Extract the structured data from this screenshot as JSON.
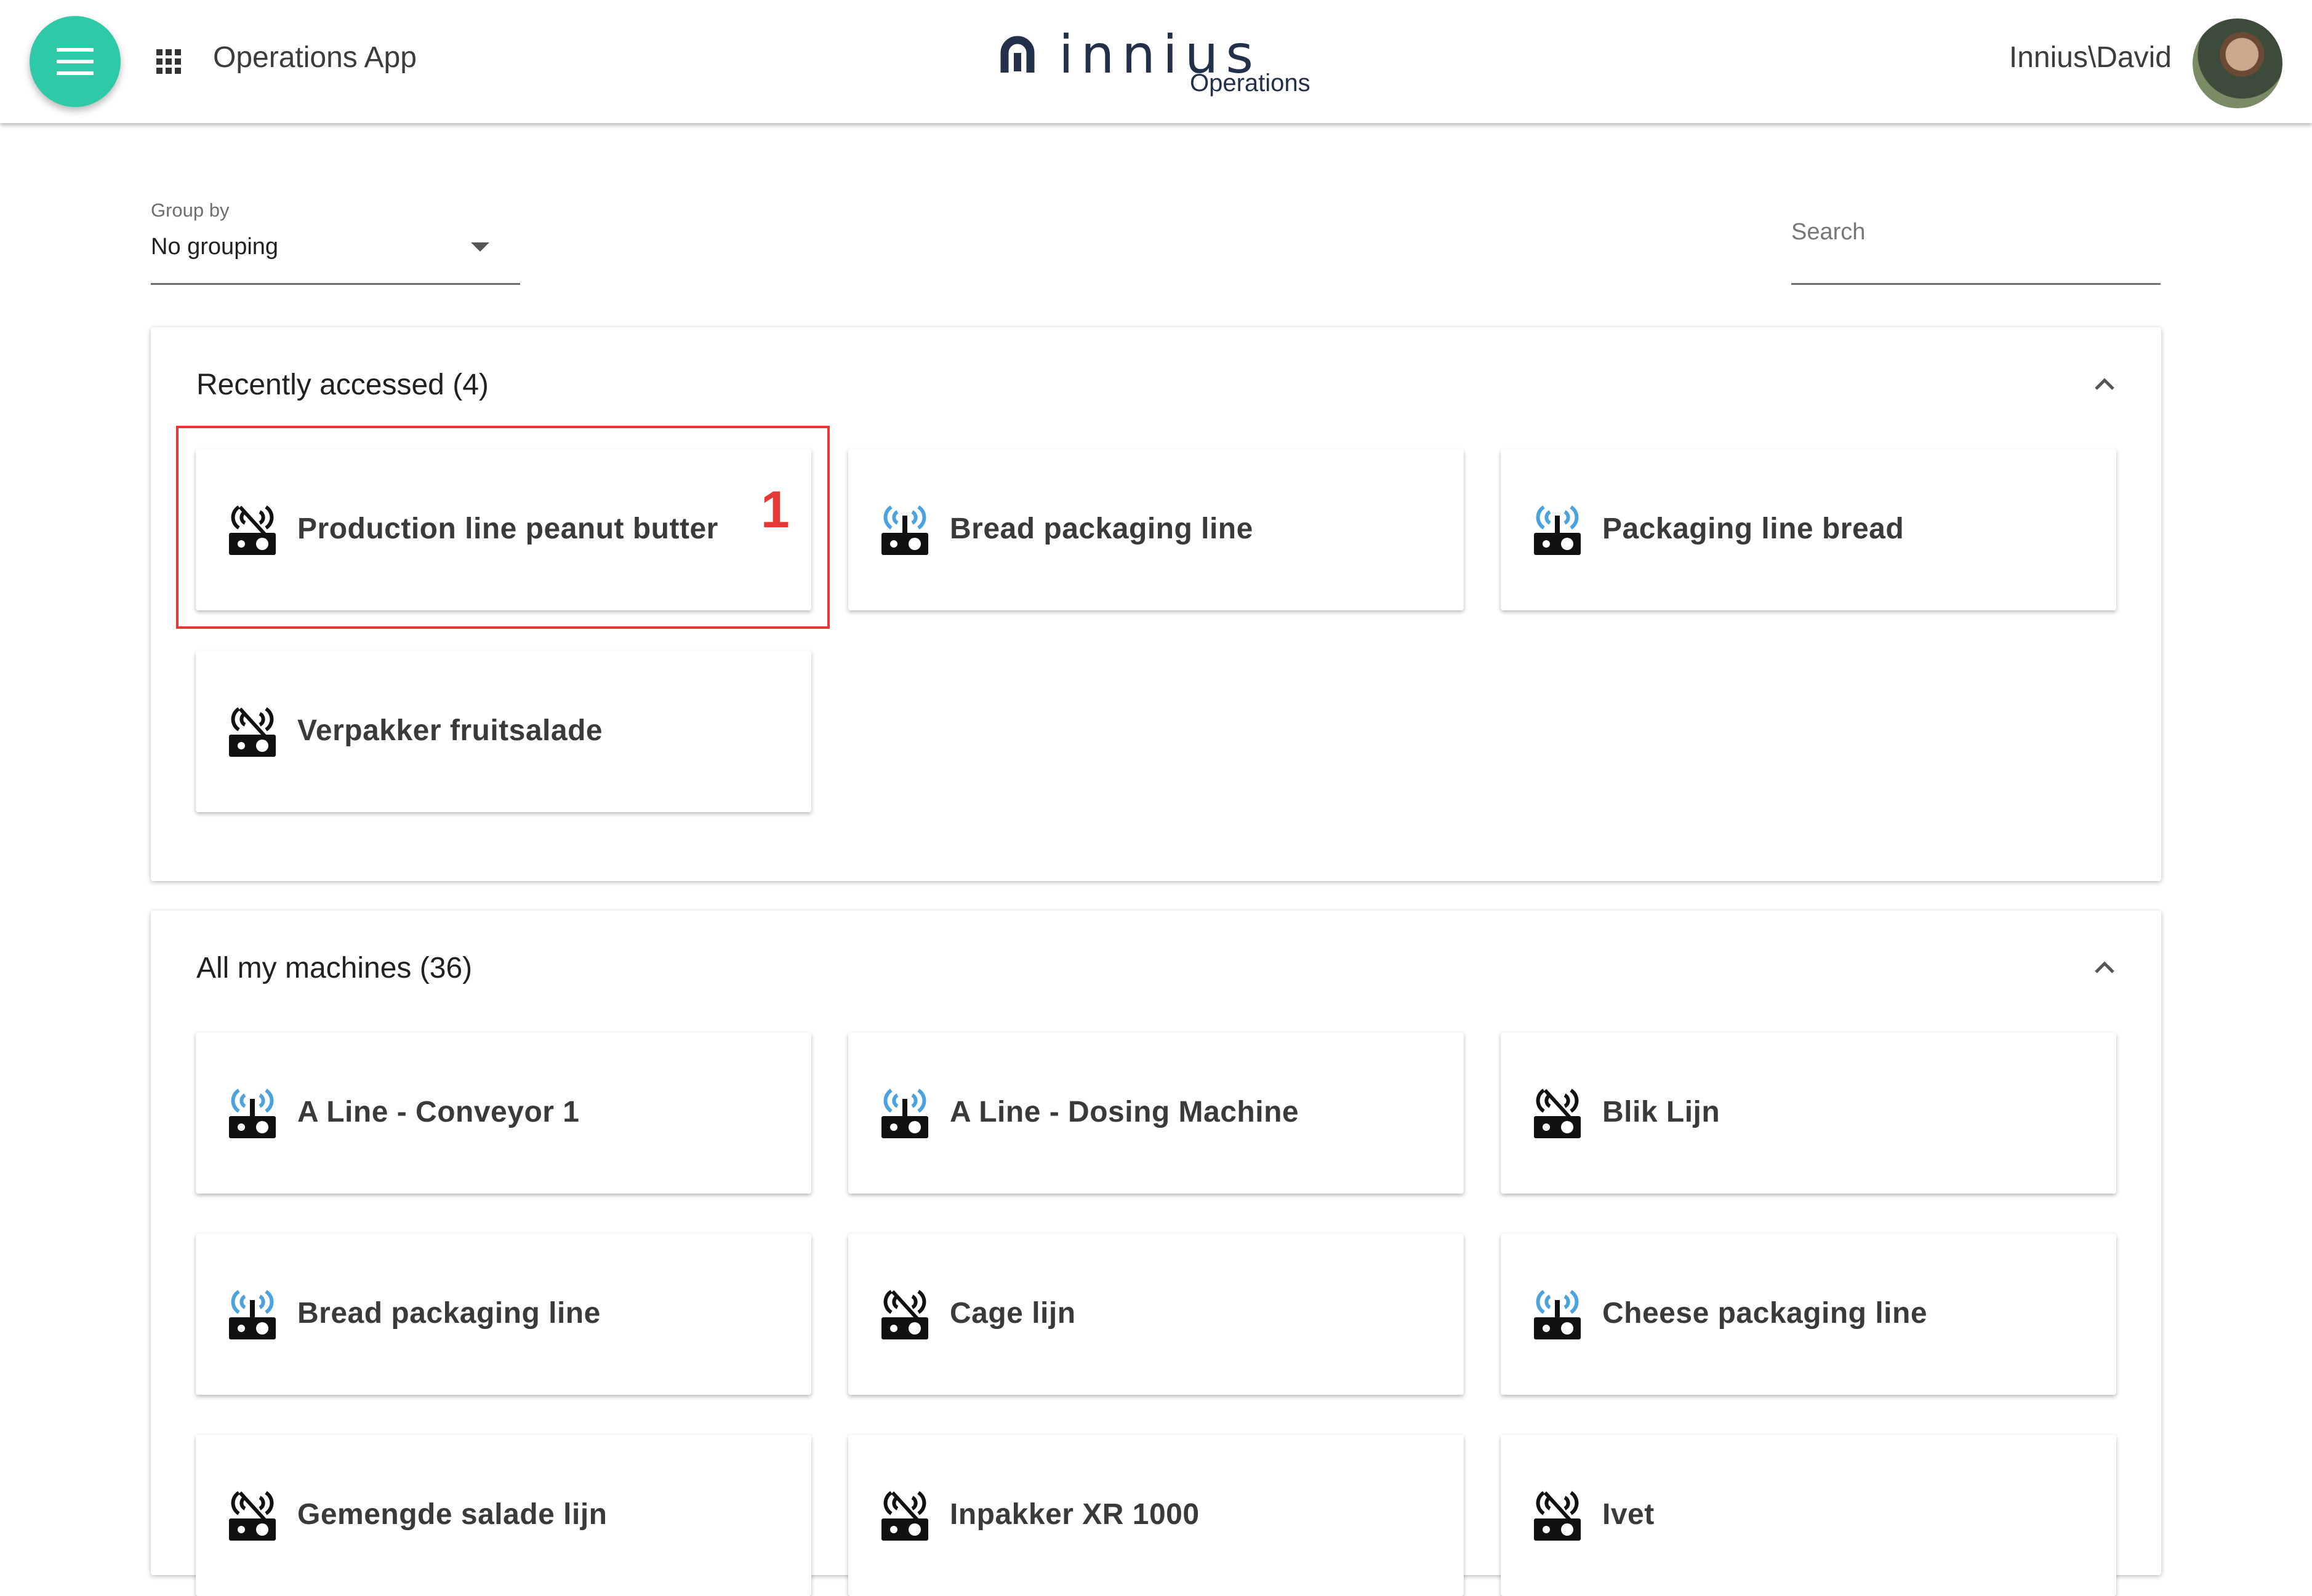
{
  "header": {
    "menu_icon": "hamburger-icon",
    "apps_icon": "apps-grid-icon",
    "app_title": "Operations App",
    "logo_text": "innius",
    "logo_sub": "Operations",
    "username": "Innius\\David",
    "accent_color": "#2ec9a6"
  },
  "filters": {
    "group_by_label": "Group by",
    "group_by_value": "No grouping",
    "search_placeholder": "Search"
  },
  "recent": {
    "title": "Recently accessed (4)",
    "items": [
      {
        "label": "Production line peanut butter",
        "icon": "machine-disconnected-icon"
      },
      {
        "label": "Bread packaging line",
        "icon": "machine-connected-icon"
      },
      {
        "label": "Packaging line bread",
        "icon": "machine-connected-icon"
      },
      {
        "label": "Verpakker fruitsalade",
        "icon": "machine-disconnected-icon"
      }
    ]
  },
  "all_machines": {
    "title": "All my machines (36)",
    "items": [
      {
        "label": "A Line - Conveyor 1",
        "icon": "machine-connected-icon"
      },
      {
        "label": "A Line - Dosing Machine",
        "icon": "machine-connected-icon"
      },
      {
        "label": "Blik Lijn",
        "icon": "machine-disconnected-icon"
      },
      {
        "label": "Bread packaging line",
        "icon": "machine-connected-icon"
      },
      {
        "label": "Cage lijn",
        "icon": "machine-disconnected-icon"
      },
      {
        "label": "Cheese packaging line",
        "icon": "machine-connected-icon"
      },
      {
        "label": "Gemengde salade lijn",
        "icon": "machine-disconnected-icon"
      },
      {
        "label": "Inpakker XR 1000",
        "icon": "machine-disconnected-icon"
      },
      {
        "label": "Ivet",
        "icon": "machine-disconnected-icon"
      }
    ]
  },
  "annotation": {
    "marker": "1",
    "color": "#e53935"
  }
}
